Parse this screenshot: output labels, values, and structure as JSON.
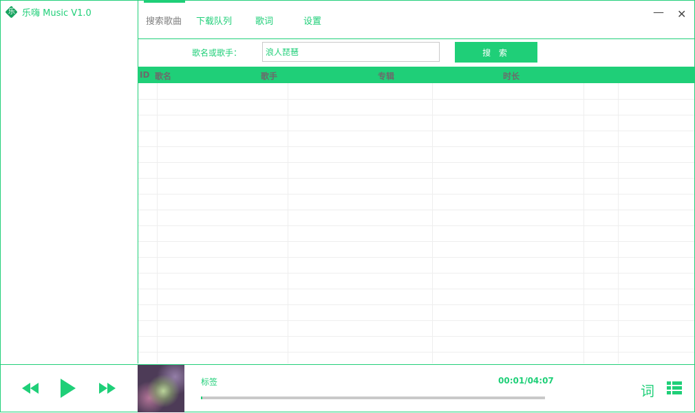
{
  "app": {
    "title": "乐嗨 Music V1.0",
    "logo_glyph": "乐",
    "accent": "#1fcf78"
  },
  "tabs": [
    {
      "label": "搜索歌曲",
      "active": true
    },
    {
      "label": "下载队列",
      "active": false
    },
    {
      "label": "歌词",
      "active": false
    },
    {
      "label": "设置",
      "active": false
    }
  ],
  "window": {
    "minimize": "—",
    "close": "✕"
  },
  "search": {
    "label": "歌名或歌手：",
    "value": "浪人琵琶",
    "button": "搜 索"
  },
  "table": {
    "columns": [
      "ID",
      "歌名",
      "歌手",
      "专辑",
      "时长"
    ],
    "rows": []
  },
  "player": {
    "track_label": "标签",
    "time": "00:01/04:07",
    "progress_fraction": 0.004,
    "lyrics_button": "词",
    "icons": {
      "prev": "rewind-icon",
      "play": "play-icon",
      "next": "fast-forward-icon",
      "playlist": "playlist-grid-icon"
    }
  }
}
